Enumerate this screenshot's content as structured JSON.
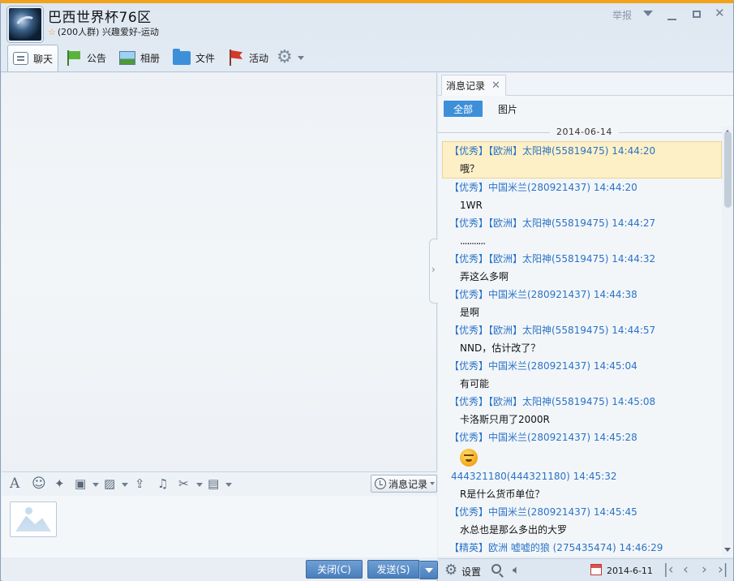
{
  "header": {
    "title": "巴西世界杯76区",
    "subtitle": "(200人群) 兴趣爱好-运动",
    "report_label": "举报"
  },
  "toolbar": {
    "items": [
      {
        "label": "聊天",
        "icon": "chat-bubble-icon"
      },
      {
        "label": "公告",
        "icon": "green-flag-icon"
      },
      {
        "label": "相册",
        "icon": "album-icon"
      },
      {
        "label": "文件",
        "icon": "folder-icon"
      },
      {
        "label": "活动",
        "icon": "red-flag-icon"
      }
    ]
  },
  "input_toolbar": {
    "msg_record_label": "消息记录"
  },
  "buttons": {
    "close_label": "关闭(C)",
    "send_label": "发送(S)"
  },
  "right_panel": {
    "tab_label": "消息记录",
    "filter_all": "全部",
    "filter_pictures": "图片",
    "date_separator": "2014-06-14",
    "messages": [
      {
        "meta": "【优秀】【欧洲】太阳神(55819475) 14:44:20",
        "body": "哦？",
        "highlight": true
      },
      {
        "meta": "【优秀】中国米兰(280921437) 14:44:20",
        "body": "1WR"
      },
      {
        "meta": "【优秀】【欧洲】太阳神(55819475) 14:44:27",
        "body": "..........."
      },
      {
        "meta": "【优秀】【欧洲】太阳神(55819475) 14:44:32",
        "body": "弄这么多啊"
      },
      {
        "meta": "【优秀】中国米兰(280921437) 14:44:38",
        "body": "是啊"
      },
      {
        "meta": "【优秀】【欧洲】太阳神(55819475) 14:44:57",
        "body": "NND，估计改了？"
      },
      {
        "meta": "【优秀】中国米兰(280921437) 14:45:04",
        "body": "有可能"
      },
      {
        "meta": "【优秀】【欧洲】太阳神(55819475) 14:45:08",
        "body": "卡洛斯只用了2000R"
      },
      {
        "meta": "【优秀】中国米兰(280921437) 14:45:28",
        "body": "",
        "emoji": "grinning-face-emoji"
      },
      {
        "meta": "444321180(444321180) 14:45:32",
        "body": "R是什么货币单位？",
        "plain": true
      },
      {
        "meta": "【优秀】中国米兰(280921437) 14:45:45",
        "body": "水总也是那么多出的大罗"
      },
      {
        "meta": "【精英】欧洲 嘘嘘的狼 (275435474) 14:46:29",
        "body": ""
      }
    ],
    "bottom": {
      "settings_label": "设置",
      "date": "2014-6-11"
    }
  }
}
